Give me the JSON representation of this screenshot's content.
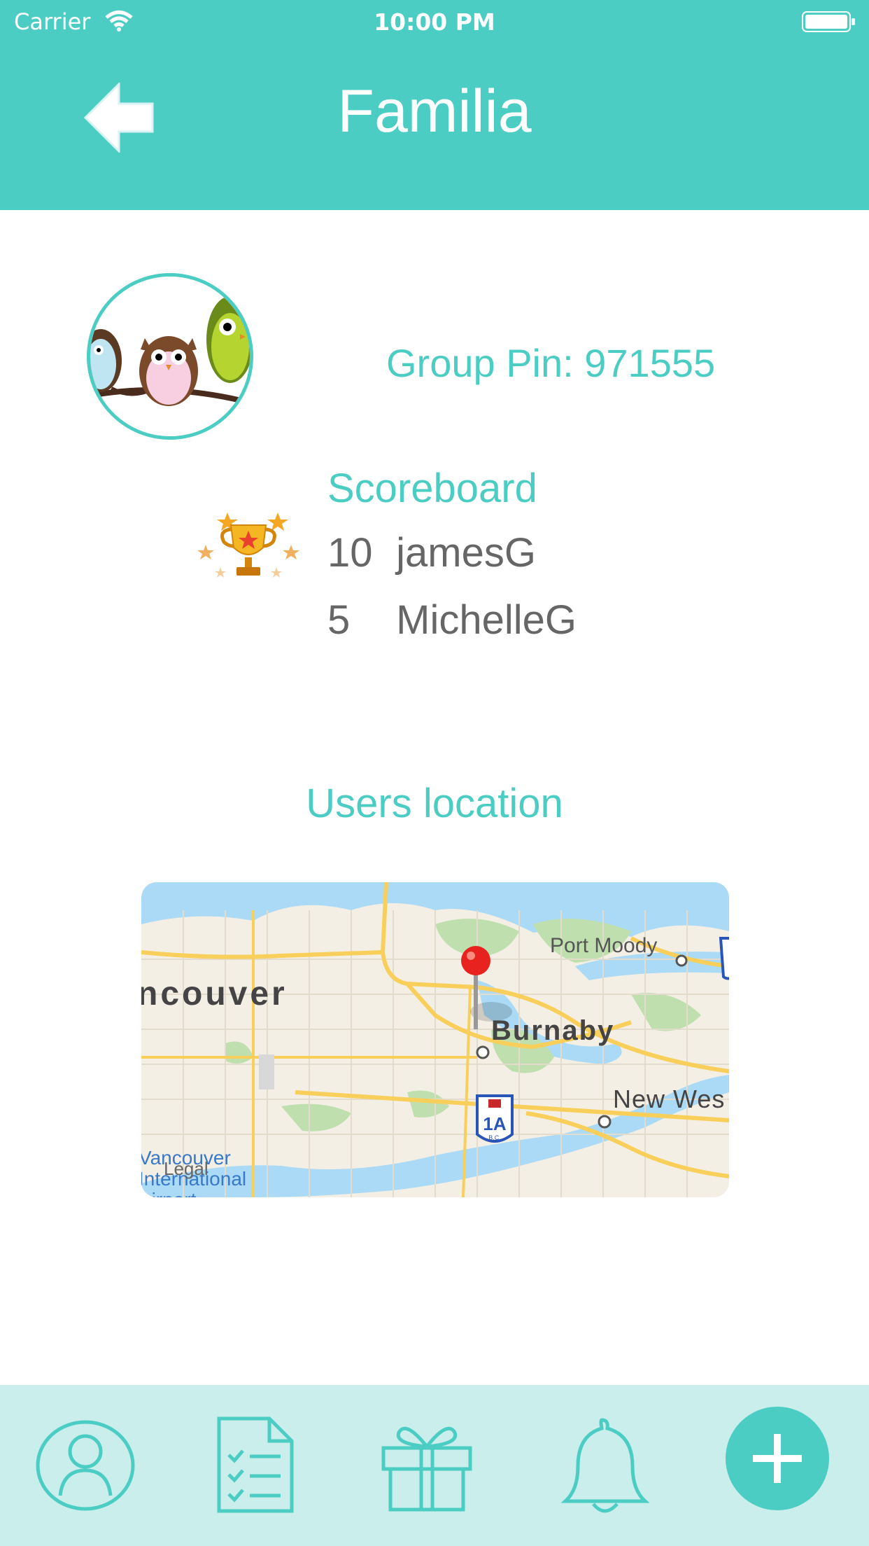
{
  "status_bar": {
    "carrier": "Carrier",
    "time": "10:00 PM"
  },
  "header": {
    "title": "Familia"
  },
  "group": {
    "pin_text": "Group Pin: 971555"
  },
  "scoreboard": {
    "title": "Scoreboard",
    "entries": [
      {
        "points": "10",
        "user": "jamesG"
      },
      {
        "points": "5",
        "user": "MichelleG"
      }
    ]
  },
  "location": {
    "title": "Users location"
  },
  "map": {
    "labels": {
      "vancouver": "ncouver",
      "port_moody": "Port Moody",
      "burnaby": "Burnaby",
      "new_west": "New Wes",
      "airport_1": "Vancouver",
      "airport_2": "International",
      "airport_3": "Airport",
      "legal": "Legal",
      "shield": "1A",
      "shield_sub": "B.C."
    }
  },
  "tabbar": {
    "icons": [
      "profile-icon",
      "checklist-icon",
      "gift-icon",
      "bell-icon",
      "add-icon"
    ]
  },
  "colors": {
    "accent": "#4ccdc4",
    "tabbar_bg": "#c9eeec",
    "text_gray": "#666666"
  }
}
